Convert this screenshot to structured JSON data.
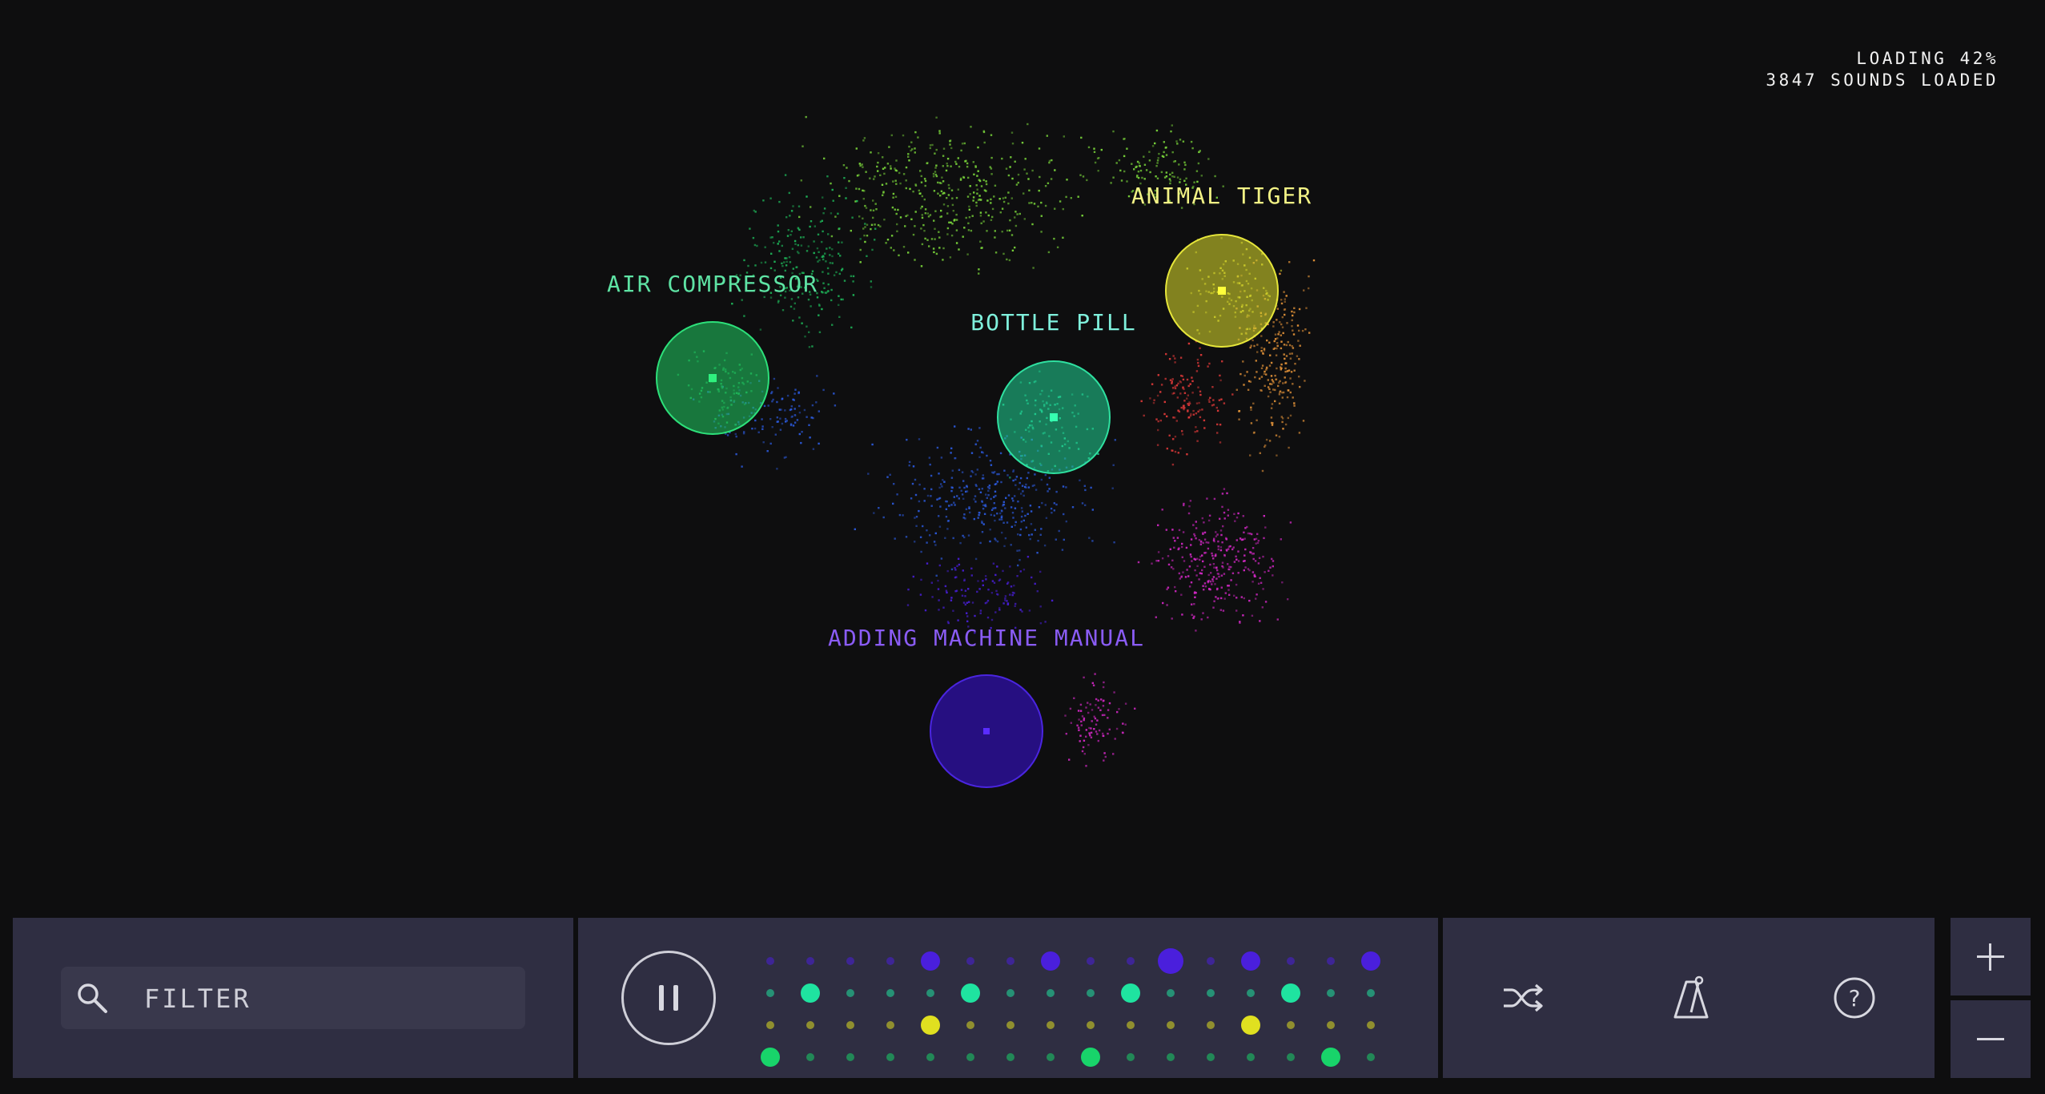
{
  "status": {
    "loading": "LOADING 42%",
    "sounds": "3847 SOUNDS LOADED",
    "loading_progress": 42,
    "sounds_loaded": 3847
  },
  "map": {
    "colors": {
      "green": "#1eb85a",
      "teal": "#20d89a",
      "yellow": "#d6d62a",
      "violet": "#4a1fdc",
      "red": "#e23a3a",
      "magenta": "#d628c8",
      "orange": "#e8963a",
      "blue": "#2c5be0",
      "lime": "#7ddc3c"
    },
    "nodes": [
      {
        "label": "AIR COMPRESSOR",
        "color": "#1eb85a",
        "label_color": "#5ee3a4"
      },
      {
        "label": "BOTTLE PILL",
        "color": "#1fc58a",
        "label_color": "#7ff0dc"
      },
      {
        "label": "ANIMAL TIGER",
        "color": "#c9c92a",
        "label_color": "#f2f285"
      },
      {
        "label": "ADDING MACHINE MANUAL",
        "color": "#3510c8",
        "label_color": "#8a5cf5"
      }
    ]
  },
  "filter": {
    "placeholder": "FILTER",
    "icon": "search-icon"
  },
  "transport": {
    "state": "playing",
    "icon": "pause-icon"
  },
  "sequencer": {
    "steps": 16,
    "rows": [
      {
        "color": "#4a1fdc",
        "active": [
          4,
          7,
          10,
          12,
          15
        ],
        "accent": [
          10
        ]
      },
      {
        "color": "#1fe3a0",
        "active": [
          1,
          5,
          9,
          13
        ],
        "accent": []
      },
      {
        "color": "#e0e020",
        "active": [
          4,
          12
        ],
        "accent": []
      },
      {
        "color": "#18d46a",
        "active": [
          0,
          8,
          14
        ],
        "accent": []
      }
    ]
  },
  "tools": {
    "shuffle_icon": "shuffle-icon",
    "metronome_icon": "metronome-icon",
    "help_icon": "help-icon",
    "help_glyph": "?"
  },
  "zoom": {
    "in_icon": "plus-icon",
    "out_icon": "minus-icon"
  }
}
